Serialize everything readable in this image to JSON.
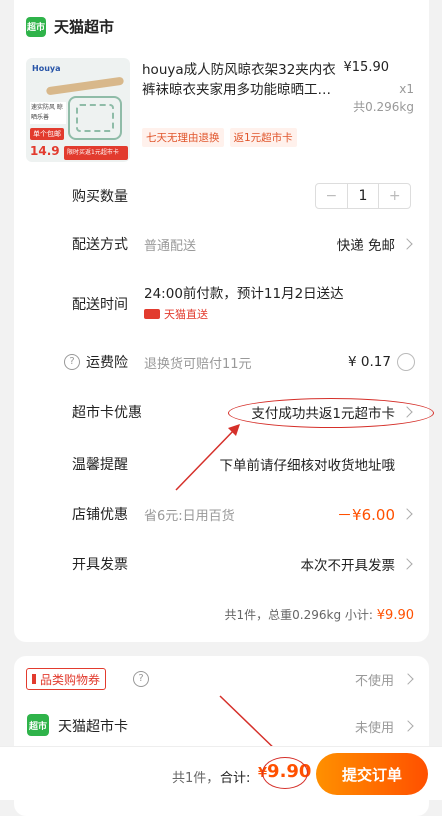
{
  "store": {
    "logo_text": "超市",
    "name": "天猫超市"
  },
  "product": {
    "title": "houya成人防风晾衣架32夹内衣裤袜晾衣夹家用多功能晾晒工…",
    "price": "¥15.90",
    "quantity": "x1",
    "weight": "共0.296kg",
    "image": {
      "brand": "Houya",
      "tag_text": "速实防风 晾晒乐善",
      "red_label": "单个包邮",
      "price": "14.9",
      "banner": "限时买返1元超市卡"
    },
    "tags": [
      "七天无理由退换",
      "返1元超市卡"
    ]
  },
  "rows": {
    "quantity": {
      "label": "购买数量",
      "minus": "−",
      "value": "1",
      "plus": "+"
    },
    "delivery": {
      "label": "配送方式",
      "sub": "普通配送",
      "value": "快递 免邮"
    },
    "delivery_time": {
      "label": "配送时间",
      "main": "24:00前付款，预计11月2日送达",
      "badge": "天猫直送"
    },
    "shipping_insurance": {
      "help": "?",
      "label": "运费险",
      "sub": "退换货可赔付11元",
      "value": "¥ 0.17"
    },
    "supermarket_card": {
      "label": "超市卡优惠",
      "value": "支付成功共返1元超市卡"
    },
    "reminder": {
      "label": "温馨提醒",
      "value": "下单前请仔细核对收货地址哦"
    },
    "store_discount": {
      "label": "店铺优惠",
      "sub": "省6元:日用百货",
      "value": "－¥6.00"
    },
    "invoice": {
      "label": "开具发票",
      "value": "本次不开具发票"
    }
  },
  "summary": {
    "text": "共1件，总重0.296kg 小计:",
    "amount": "¥9.90"
  },
  "coupons": {
    "category_coupon": {
      "label": "品类购物券",
      "help": "?",
      "value": "不使用"
    },
    "tmall_card": {
      "logo_text": "超市",
      "name": "天猫超市卡",
      "value": "未使用"
    }
  },
  "bottom": {
    "count": "共1件，",
    "total_label": "合计:",
    "currency": "¥",
    "total": "9.90",
    "submit": "提交订单"
  },
  "colors": {
    "accent": "#ff5000",
    "brand_green": "#2fb34a",
    "annotation_red": "#d5302a"
  }
}
